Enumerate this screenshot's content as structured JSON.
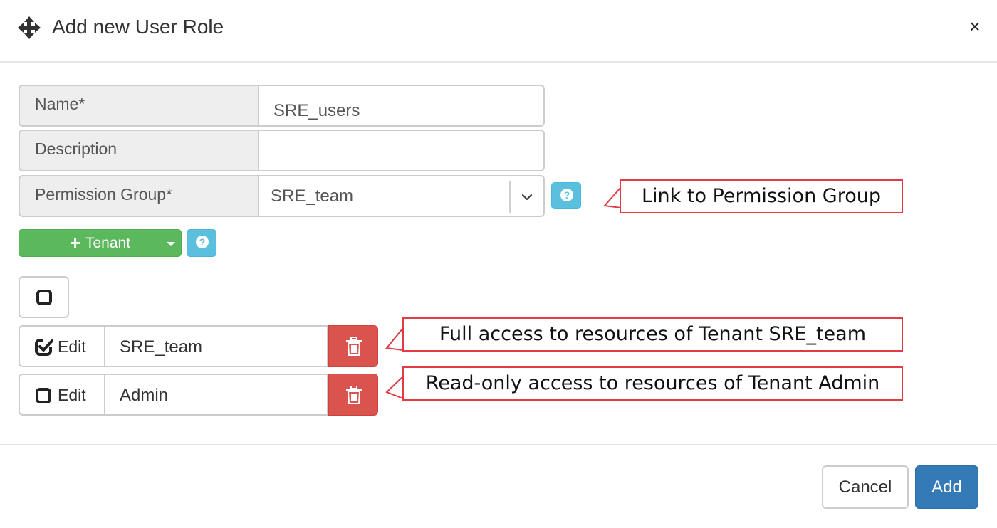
{
  "header": {
    "title": "Add new User Role",
    "close_label": "×"
  },
  "form": {
    "name": {
      "label": "Name*",
      "value": "SRE_users"
    },
    "description": {
      "label": "Description",
      "value": ""
    },
    "permission_group": {
      "label": "Permission Group*",
      "value": "SRE_team"
    }
  },
  "tenant_button": {
    "label": "Tenant"
  },
  "tenants": [
    {
      "checked": true,
      "edit_label": "Edit",
      "name": "SRE_team"
    },
    {
      "checked": false,
      "edit_label": "Edit",
      "name": "Admin"
    }
  ],
  "callouts": {
    "permission_group": "Link to Permission Group",
    "tenant_1": "Full access to resources of Tenant SRE_team",
    "tenant_2": "Read-only access to resources of Tenant Admin"
  },
  "footer": {
    "cancel_label": "Cancel",
    "add_label": "Add"
  },
  "colors": {
    "success": "#5cb85c",
    "info": "#5bc0de",
    "danger": "#d9534f",
    "primary": "#337ab7",
    "callout_border": "#e23b45"
  }
}
